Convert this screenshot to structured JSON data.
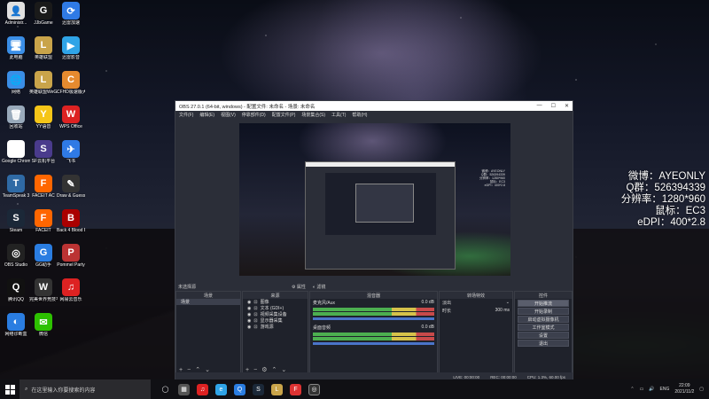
{
  "desktop_icons": [
    {
      "label": "Administr...",
      "color": "#e0e0e0",
      "glyph": "👤"
    },
    {
      "label": "JJbGame",
      "color": "#1a1a1a",
      "glyph": "G"
    },
    {
      "label": "迅雷加速",
      "color": "#2f7ae5",
      "glyph": "⟳"
    },
    {
      "label": "此电脑",
      "color": "#3a8ee6",
      "glyph": "🖥"
    },
    {
      "label": "英雄联盟",
      "color": "#c9a44a",
      "glyph": "L"
    },
    {
      "label": "迅雷影音",
      "color": "#2fa4e7",
      "glyph": "▶"
    },
    {
      "label": "网络",
      "color": "#3a8ee6",
      "glyph": "🌐"
    },
    {
      "label": "英雄联盟WeGame版",
      "color": "#c9a44a",
      "glyph": "L"
    },
    {
      "label": "CFHD极速版大厅",
      "color": "#e58a2f",
      "glyph": "C"
    },
    {
      "label": "回收站",
      "color": "#9ab",
      "glyph": "🗑"
    },
    {
      "label": "YY语音",
      "color": "#f5c518",
      "glyph": "Y"
    },
    {
      "label": "WPS Office",
      "color": "#d22",
      "glyph": "W"
    },
    {
      "label": "Google Chrome",
      "color": "#fff",
      "glyph": "◉"
    },
    {
      "label": "SF云机平台",
      "color": "#4a3b8c",
      "glyph": "S"
    },
    {
      "label": "飞书",
      "color": "#2f7ae5",
      "glyph": "✈"
    },
    {
      "label": "TeamSpeak 3",
      "color": "#2f6aa5",
      "glyph": "T"
    },
    {
      "label": "FACEIT AC",
      "color": "#f60",
      "glyph": "F"
    },
    {
      "label": "Draw & Guess",
      "color": "#333",
      "glyph": "✎"
    },
    {
      "label": "Steam",
      "color": "#1b2838",
      "glyph": "S"
    },
    {
      "label": "FACEIT",
      "color": "#f60",
      "glyph": "F"
    },
    {
      "label": "Back 4 Blood Beta",
      "color": "#a00",
      "glyph": "B"
    },
    {
      "label": "OBS Studio",
      "color": "#222",
      "glyph": "◎"
    },
    {
      "label": "GG助手",
      "color": "#2a7de1",
      "glyph": "G"
    },
    {
      "label": "Pommel Party",
      "color": "#b33",
      "glyph": "P"
    },
    {
      "label": "腾讯QQ",
      "color": "#111",
      "glyph": "Q"
    },
    {
      "label": "完美世界竞技平台",
      "color": "#333",
      "glyph": "W"
    },
    {
      "label": "网易云音乐",
      "color": "#d22",
      "glyph": "♫"
    },
    {
      "label": "网络诊断盒",
      "color": "#2a7de1",
      "glyph": "◐"
    },
    {
      "label": "微信",
      "color": "#2dc100",
      "glyph": "✉"
    }
  ],
  "obs": {
    "title": "OBS 27.0.1 (64-bit, windows) - 配置文件: 未命名 - 场景: 未命名",
    "menu": [
      "文件(F)",
      "编辑(E)",
      "视图(V)",
      "停靠部件(D)",
      "配置文件(P)",
      "场景集合(S)",
      "工具(T)",
      "帮助(H)"
    ],
    "no_source_label": "未选择源",
    "props_label": "属性",
    "filters_label": "滤镜",
    "docks": {
      "scenes": {
        "title": "场景",
        "items": [
          "场景"
        ]
      },
      "sources": {
        "title": "来源",
        "items": [
          "图像",
          "文本 (GDI+)",
          "视频采集设备",
          "显示器采集",
          "游戏源"
        ]
      },
      "mixer": {
        "title": "混音器",
        "tracks": [
          {
            "name": "桌面音频",
            "db": "0.0 dB"
          },
          {
            "name": "麦克风/Aux",
            "db": "0.0 dB"
          }
        ]
      },
      "transitions": {
        "title": "转场特效",
        "type": "淡出",
        "duration_label": "时长",
        "duration": "300 ms"
      },
      "controls": {
        "title": "控件",
        "buttons": [
          "开始推流",
          "开始录制",
          "启动虚拟摄像机",
          "工作室模式",
          "设置",
          "退出"
        ]
      }
    },
    "status": {
      "live": "LIVE: 00:00:00",
      "rec": "REC: 00:00:00",
      "cpu": "CPU: 1.3%, 60.00 fps"
    }
  },
  "overlay_lines": [
    "微博：AYEONLY",
    "Q群：526394339",
    "分辨率：1280*960",
    "鼠标：EC3",
    "eDPI：400*2.8"
  ],
  "taskbar": {
    "search_placeholder": "在这里输入你要搜索的内容",
    "lang": "ENG",
    "time": "22:09",
    "date": "2021/11/2"
  }
}
